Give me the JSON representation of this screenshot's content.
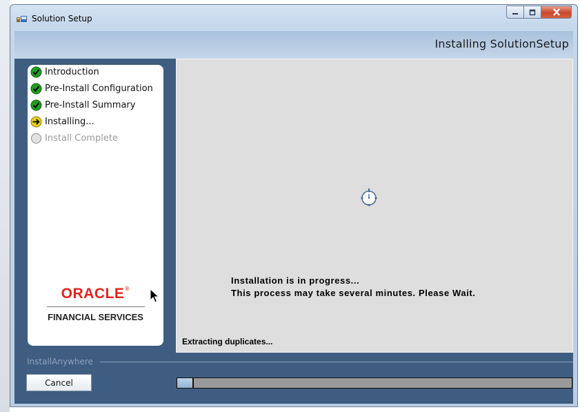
{
  "window": {
    "title": "Solution Setup",
    "header_title": "Installing SolutionSetup"
  },
  "steps": [
    {
      "label": "Introduction",
      "state": "complete"
    },
    {
      "label": "Pre-Install Configuration",
      "state": "complete"
    },
    {
      "label": "Pre-Install Summary",
      "state": "complete"
    },
    {
      "label": "Installing...",
      "state": "current"
    },
    {
      "label": "Install Complete",
      "state": "pending"
    }
  ],
  "logo": {
    "wordmark": "ORACLE",
    "registered": "®",
    "subtitle": "FINANCIAL SERVICES"
  },
  "main": {
    "progress_line1": "Installation is in progress...",
    "progress_line2": "This process may take several minutes. Please Wait.",
    "status": "Extracting duplicates..."
  },
  "footer": {
    "brand": "InstallAnywhere",
    "cancel_label": "Cancel",
    "progress_fraction": 0.04
  },
  "colors": {
    "accent": "#3e5d80",
    "oracle_red": "#e2231a",
    "complete_green": "#1f9d1f",
    "current_yellow": "#e7d11a"
  },
  "icons": {
    "complete": "check-circle-icon",
    "current": "arrow-right-circle-icon",
    "pending": "empty-circle-icon"
  }
}
